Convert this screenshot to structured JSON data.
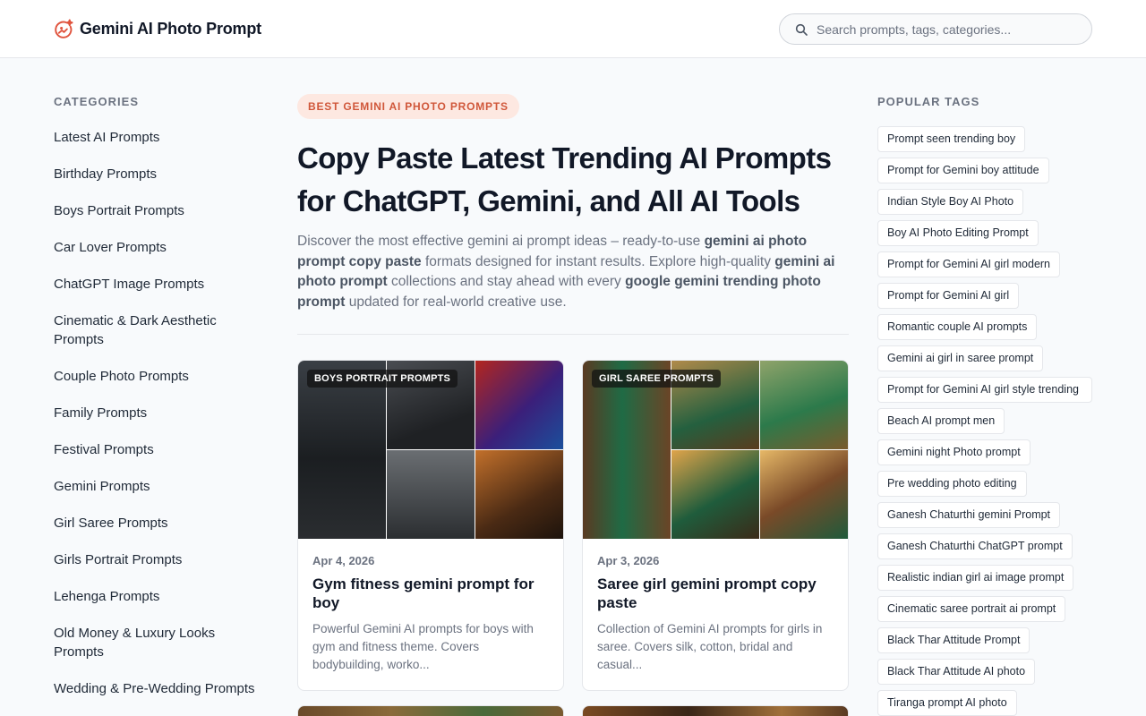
{
  "header": {
    "brand": "Gemini AI Photo Prompt",
    "search_placeholder": "Search prompts, tags, categories..."
  },
  "sidebar": {
    "title": "CATEGORIES",
    "items": [
      "Latest AI Prompts",
      "Birthday Prompts",
      "Boys Portrait Prompts",
      "Car Lover Prompts",
      "ChatGPT Image Prompts",
      "Cinematic & Dark Aesthetic Prompts",
      "Couple Photo Prompts",
      "Family Prompts",
      "Festival Prompts",
      "Gemini Prompts",
      "Girl Saree Prompts",
      "Girls Portrait Prompts",
      "Lehenga Prompts",
      "Old Money & Luxury Looks Prompts",
      "Wedding & Pre-Wedding Prompts"
    ]
  },
  "hero": {
    "eyebrow": "BEST GEMINI AI PHOTO PROMPTS",
    "title": "Copy Paste Latest Trending AI Prompts for ChatGPT, Gemini, and All AI Tools",
    "desc_1": "Discover the most effective gemini ai prompt ideas – ready-to-use ",
    "desc_b1": "gemini ai photo prompt copy paste",
    "desc_2": " formats designed for instant results. Explore high-quality ",
    "desc_b2": "gemini ai photo prompt",
    "desc_3": " collections and stay ahead with every ",
    "desc_b3": "google gemini trending photo prompt",
    "desc_4": " updated for real-world creative use."
  },
  "cards": [
    {
      "badge": "BOYS PORTRAIT PROMPTS",
      "date": "Apr 4, 2026",
      "title": "Gym fitness gemini prompt for boy",
      "excerpt": "Powerful Gemini AI prompts for boys with gym and fitness theme. Covers bodybuilding, worko..."
    },
    {
      "badge": "GIRL SAREE PROMPTS",
      "date": "Apr 3, 2026",
      "title": "Saree girl gemini prompt copy paste",
      "excerpt": "Collection of Gemini AI prompts for girls in saree. Covers silk, cotton, bridal and casual..."
    }
  ],
  "tags": {
    "title": "POPULAR TAGS",
    "items": [
      "Prompt seen trending boy",
      "Prompt for Gemini boy attitude",
      "Indian Style Boy AI Photo",
      "Boy AI Photo Editing Prompt",
      "Prompt for Gemini AI girl modern",
      "Prompt for Gemini AI girl",
      "Romantic couple AI prompts",
      "Gemini ai girl in saree prompt",
      "Prompt for Gemini AI girl style trending",
      "Beach AI prompt men",
      "Gemini night Photo prompt",
      "Pre wedding photo editing",
      "Ganesh Chaturthi gemini Prompt",
      "Ganesh Chaturthi ChatGPT prompt",
      "Realistic indian girl ai image prompt",
      "Cinematic saree portrait ai prompt",
      "Black Thar Attitude Prompt",
      "Black Thar Attitude AI photo",
      "Tiranga prompt AI photo"
    ]
  },
  "colors": {
    "accent": "#e0533d",
    "eyebrow_bg": "#fde8e1",
    "eyebrow_text": "#d0573a"
  }
}
